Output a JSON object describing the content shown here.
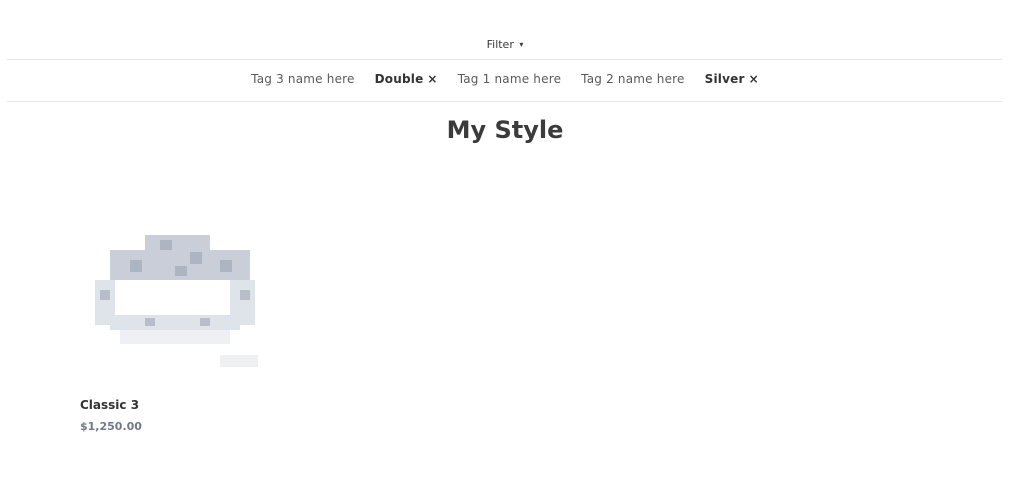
{
  "filter": {
    "label": "Filter",
    "caret": "▾"
  },
  "tags": [
    {
      "label": "Tag 3 name here",
      "active": false
    },
    {
      "label": "Double",
      "active": true,
      "remove": "×"
    },
    {
      "label": "Tag 1 name here",
      "active": false
    },
    {
      "label": "Tag 2 name here",
      "active": false
    },
    {
      "label": "Silver",
      "active": true,
      "remove": "×"
    }
  ],
  "collection": {
    "title": "My Style"
  },
  "products": [
    {
      "name": "Classic 3",
      "price": "$1,250.00",
      "image_icon": "ring-image"
    }
  ],
  "colors": {
    "text": "#3a3a3a",
    "price": "#6f7a88",
    "rule": "#e6e6e6"
  }
}
